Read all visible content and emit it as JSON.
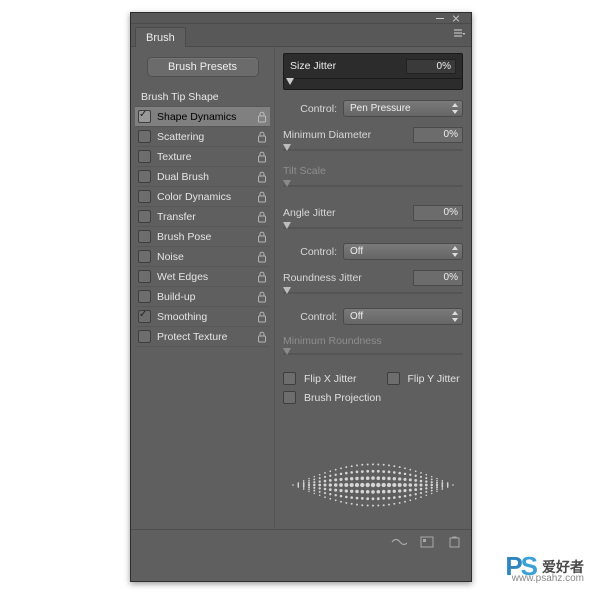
{
  "panel": {
    "title": "Brush"
  },
  "presets_button": "Brush Presets",
  "side_options": [
    {
      "label": "Brush Tip Shape",
      "checkbox": false,
      "checked": false,
      "lock": false,
      "selected": false,
      "header": true
    },
    {
      "label": "Shape Dynamics",
      "checkbox": true,
      "checked": true,
      "lock": true,
      "selected": true
    },
    {
      "label": "Scattering",
      "checkbox": true,
      "checked": false,
      "lock": true
    },
    {
      "label": "Texture",
      "checkbox": true,
      "checked": false,
      "lock": true
    },
    {
      "label": "Dual Brush",
      "checkbox": true,
      "checked": false,
      "lock": true
    },
    {
      "label": "Color Dynamics",
      "checkbox": true,
      "checked": false,
      "lock": true
    },
    {
      "label": "Transfer",
      "checkbox": true,
      "checked": false,
      "lock": true
    },
    {
      "label": "Brush Pose",
      "checkbox": true,
      "checked": false,
      "lock": true
    },
    {
      "label": "Noise",
      "checkbox": true,
      "checked": false,
      "lock": true
    },
    {
      "label": "Wet Edges",
      "checkbox": true,
      "checked": false,
      "lock": true
    },
    {
      "label": "Build-up",
      "checkbox": true,
      "checked": false,
      "lock": true
    },
    {
      "label": "Smoothing",
      "checkbox": true,
      "checked": true,
      "lock": true
    },
    {
      "label": "Protect Texture",
      "checkbox": true,
      "checked": false,
      "lock": true
    }
  ],
  "settings": {
    "size_jitter": {
      "label": "Size Jitter",
      "value": "0%"
    },
    "size_control": {
      "label": "Control:",
      "value": "Pen Pressure"
    },
    "min_diameter": {
      "label": "Minimum Diameter",
      "value": "0%"
    },
    "tilt_scale": {
      "label": "Tilt Scale",
      "value": ""
    },
    "angle_jitter": {
      "label": "Angle Jitter",
      "value": "0%"
    },
    "angle_control": {
      "label": "Control:",
      "value": "Off"
    },
    "roundness_jitter": {
      "label": "Roundness Jitter",
      "value": "0%"
    },
    "round_control": {
      "label": "Control:",
      "value": "Off"
    },
    "min_roundness": {
      "label": "Minimum Roundness",
      "value": ""
    },
    "flip_x": {
      "label": "Flip X Jitter",
      "checked": false
    },
    "flip_y": {
      "label": "Flip Y Jitter",
      "checked": false
    },
    "brush_proj": {
      "label": "Brush Projection",
      "checked": false
    }
  },
  "watermark": {
    "brand": "PS",
    "text": "爱好者",
    "url": "www.psahz.com"
  }
}
